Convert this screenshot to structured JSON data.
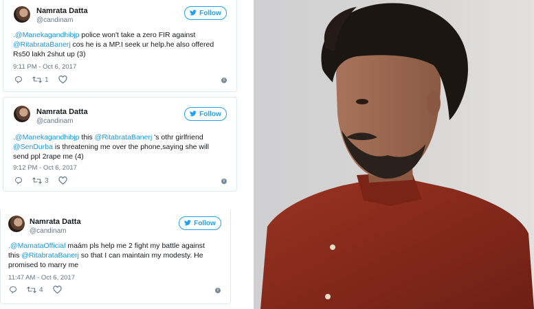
{
  "tweets": [
    {
      "name": "Namrata Datta",
      "handle": "@candinam",
      "follow_label": "Follow",
      "lines": [
        [
          {
            "t": ".@Manekagandhibjp",
            "m": true
          },
          {
            "t": " police won't take a zero FIR against",
            "m": false
          }
        ],
        [
          {
            "t": "@RitabrataBanerj",
            "m": true
          },
          {
            "t": " cos he is a MP.I seek ur help.he also offered",
            "m": false
          }
        ],
        [
          {
            "t": "Rs50 lakh 2shut up (3)",
            "m": false
          }
        ]
      ],
      "timestamp": "9:11 PM - Oct 6, 2017",
      "retweets": "1"
    },
    {
      "name": "Namrata Datta",
      "handle": "@candinam",
      "follow_label": "Follow",
      "lines": [
        [
          {
            "t": ".@Manekagandhibjp",
            "m": true
          },
          {
            "t": " this ",
            "m": false
          },
          {
            "t": "@RitabrataBanerj",
            "m": true
          },
          {
            "t": " 's othr girlfriend",
            "m": false
          }
        ],
        [
          {
            "t": "@SenDurba",
            "m": true
          },
          {
            "t": " is threatening me over the phone,saying she will",
            "m": false
          }
        ],
        [
          {
            "t": "send ppl 2rape me (4)",
            "m": false
          }
        ]
      ],
      "timestamp": "9:12 PM - Oct 6, 2017",
      "retweets": "3"
    },
    {
      "name": "Namrata Datta",
      "handle": "@candinam",
      "follow_label": "Follow",
      "lines": [
        [
          {
            "t": ".@MamataOfficial",
            "m": true
          },
          {
            "t": " maám pls help me 2 fight my battle against",
            "m": false
          }
        ],
        [
          {
            "t": "this ",
            "m": false
          },
          {
            "t": "@RitabrataBanerj",
            "m": true
          },
          {
            "t": " so that I can maintain my modesty. He",
            "m": false
          }
        ],
        [
          {
            "t": "promised to marry me",
            "m": false
          }
        ]
      ],
      "timestamp": "11:47 AM - Oct 6, 2017",
      "retweets": "4"
    }
  ],
  "icons": {
    "reply": "reply-icon",
    "retweet": "retweet-icon",
    "like": "heart-icon",
    "info": "info-icon",
    "bird": "twitter-bird-icon"
  },
  "colors": {
    "twitter_blue": "#1da1f2",
    "mention": "#1b95e0",
    "meta_gray": "#657786",
    "shirt": "#8b2a1c"
  }
}
